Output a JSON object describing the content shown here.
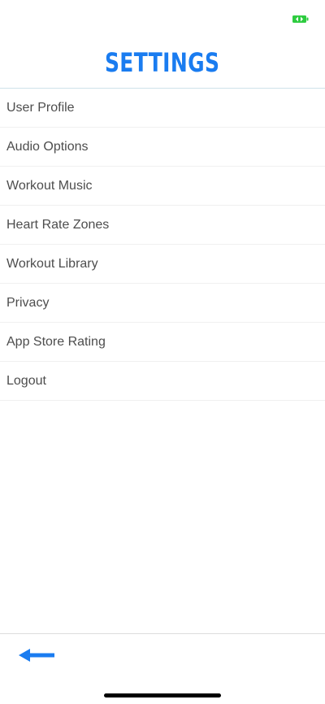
{
  "colors": {
    "accent": "#1a7cf0",
    "battery": "#2ecc40",
    "text": "#4d4d4d"
  },
  "status_bar": {
    "battery_icon": "battery-charging-icon"
  },
  "header": {
    "title": "SETTINGS"
  },
  "settings": {
    "items": [
      {
        "label": "User Profile"
      },
      {
        "label": "Audio Options"
      },
      {
        "label": "Workout Music"
      },
      {
        "label": "Heart Rate Zones"
      },
      {
        "label": "Workout Library"
      },
      {
        "label": "Privacy"
      },
      {
        "label": "App Store Rating"
      },
      {
        "label": "Logout"
      }
    ]
  },
  "bottom_bar": {
    "back_icon": "arrow-left-icon"
  }
}
